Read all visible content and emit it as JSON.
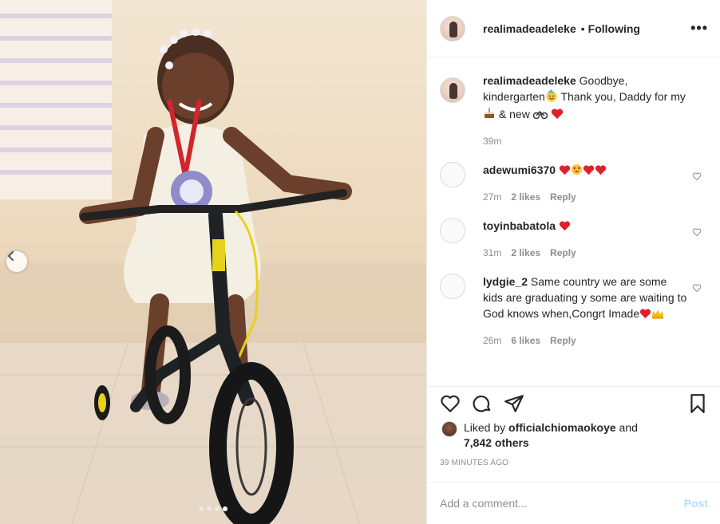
{
  "post": {
    "author": "realimadeadeleke",
    "follow_state": "Following",
    "more_icon": "more-horizontal-icon",
    "carousel": {
      "count": 4,
      "active_index": 3
    }
  },
  "caption": {
    "username": "realimadeadeleke",
    "text_part1": "Goodbye, kindergarten",
    "text_part2": " Thank you, Daddy for my ",
    "text_part3": " & new ",
    "emojis": [
      "face-with-party-hat",
      "birthday-cake",
      "bicycle",
      "red-heart"
    ],
    "time": "39m"
  },
  "comments": [
    {
      "username": "adewumi6370",
      "text": "",
      "emojis": [
        "red-heart",
        "heart-eyes",
        "red-heart",
        "red-heart"
      ],
      "time": "27m",
      "likes": "2 likes",
      "reply": "Reply"
    },
    {
      "username": "toyinbabatola",
      "text": "",
      "emojis": [
        "red-heart"
      ],
      "time": "31m",
      "likes": "2 likes",
      "reply": "Reply"
    },
    {
      "username": "lydgie_2",
      "text": "Same country we are some kids are graduating y some are waiting to God knows when,Congrt Imade",
      "emojis": [
        "red-heart",
        "crown"
      ],
      "time": "26m",
      "likes": "6 likes",
      "reply": "Reply"
    }
  ],
  "likes": {
    "prefix": "Liked by ",
    "user": "officialchiomaokoye",
    "middle": " and",
    "count": "7,842 others"
  },
  "timestamp": "39 MINUTES AGO",
  "add_comment": {
    "placeholder": "Add a comment...",
    "post_label": "Post"
  },
  "colors": {
    "heart_red": "#ed4956",
    "post_btn_disabled": "#b2dffc",
    "muted": "#8e8e8e"
  }
}
